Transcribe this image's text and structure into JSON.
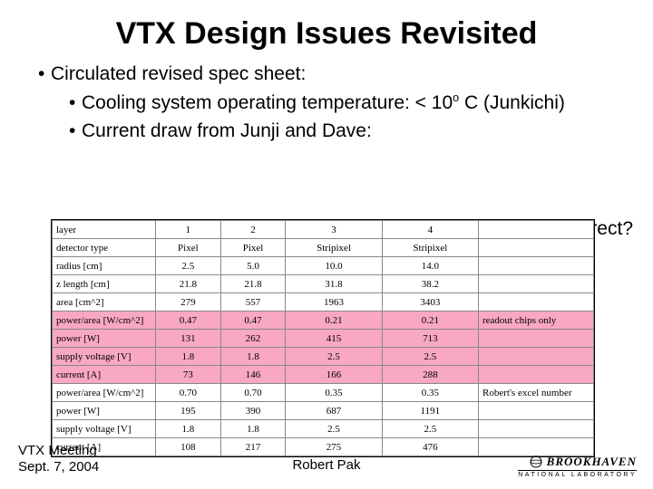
{
  "title": "VTX Design Issues Revisited",
  "bullets": {
    "l1a": "Circulated revised spec sheet:",
    "l2a_pre": "Cooling system operating temperature: < 10",
    "l2a_post": " C (Junkichi)",
    "l2b": "Current draw from Junji and Dave:"
  },
  "annot": "What's correct?",
  "table": {
    "h0": "layer",
    "h1": "1",
    "h2": "2",
    "h3": "3",
    "h4": "4",
    "r1_l": "detector type",
    "r1_1": "Pixel",
    "r1_2": "Pixel",
    "r1_3": "Stripixel",
    "r1_4": "Stripixel",
    "r2_l": "radius [cm]",
    "r2_1": "2.5",
    "r2_2": "5.0",
    "r2_3": "10.0",
    "r2_4": "14.0",
    "r3_l": "z length [cm]",
    "r3_1": "21.8",
    "r3_2": "21.8",
    "r3_3": "31.8",
    "r3_4": "38.2",
    "r4_l": "area [cm^2]",
    "r4_1": "279",
    "r4_2": "557",
    "r4_3": "1963",
    "r4_4": "3403",
    "r5_l": "power/area [W/cm^2]",
    "r5_1": "0.47",
    "r5_2": "0.47",
    "r5_3": "0.21",
    "r5_4": "0.21",
    "r5_n": "readout chips only",
    "r6_l": "power [W]",
    "r6_1": "131",
    "r6_2": "262",
    "r6_3": "415",
    "r6_4": "713",
    "r7_l": "supply voltage [V]",
    "r7_1": "1.8",
    "r7_2": "1.8",
    "r7_3": "2.5",
    "r7_4": "2.5",
    "r8_l": "current [A]",
    "r8_1": "73",
    "r8_2": "146",
    "r8_3": "166",
    "r8_4": "288",
    "r9_l": "power/area [W/cm^2]",
    "r9_1": "0.70",
    "r9_2": "0.70",
    "r9_3": "0.35",
    "r9_4": "0.35",
    "r9_n": "Robert's excel number",
    "r10_l": "power [W]",
    "r10_1": "195",
    "r10_2": "390",
    "r10_3": "687",
    "r10_4": "1191",
    "r11_l": "supply voltage [V]",
    "r11_1": "1.8",
    "r11_2": "1.8",
    "r11_3": "2.5",
    "r11_4": "2.5",
    "r12_l": "current [A]",
    "r12_1": "108",
    "r12_2": "217",
    "r12_3": "275",
    "r12_4": "476"
  },
  "footer": {
    "l1": "VTX Meeting",
    "l2": "Sept. 7, 2004",
    "center": "Robert Pak",
    "logo1": "BROOKHAVEN",
    "logo2": "NATIONAL LABORATORY"
  }
}
